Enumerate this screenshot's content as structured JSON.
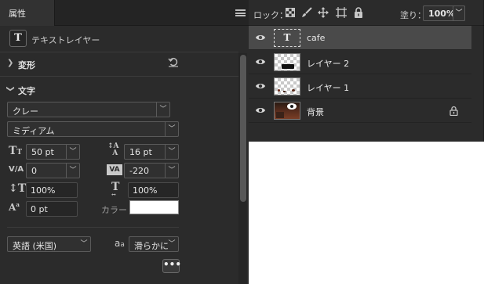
{
  "properties_panel": {
    "tab_label": "属性",
    "menu_icon": "panel-menu-icon",
    "layer_type_label": "テキストレイヤー",
    "transform": {
      "label": "変形",
      "reset_icon": "reset-icon"
    },
    "character": {
      "label": "文字",
      "font_family": "クレー",
      "font_style": "ミディアム",
      "font_size": "50 pt",
      "leading": "16 pt",
      "kerning": "0",
      "tracking": "-220",
      "vertical_scale": "100%",
      "horizontal_scale": "100%",
      "baseline_shift": "0 pt",
      "color_label": "カラー",
      "color_value": "#ffffff",
      "language": "英語 (米国)",
      "anti_alias_icon_text": "a",
      "anti_alias_icon_sub": "a",
      "anti_alias": "滑らかに",
      "more_button": "•••"
    }
  },
  "layers_panel": {
    "lock_label": "ロック：",
    "fill_label": "塗り：",
    "fill_value": "100%",
    "layers": [
      {
        "name": "cafe",
        "type": "text",
        "visible": true,
        "selected": true,
        "type_glyph": "T"
      },
      {
        "name": "レイヤー 2",
        "type": "pixel",
        "visible": true,
        "selected": false
      },
      {
        "name": "レイヤー 1",
        "type": "pixel",
        "visible": true,
        "selected": false
      },
      {
        "name": "背景",
        "type": "background",
        "visible": true,
        "selected": false,
        "locked": true
      }
    ]
  }
}
